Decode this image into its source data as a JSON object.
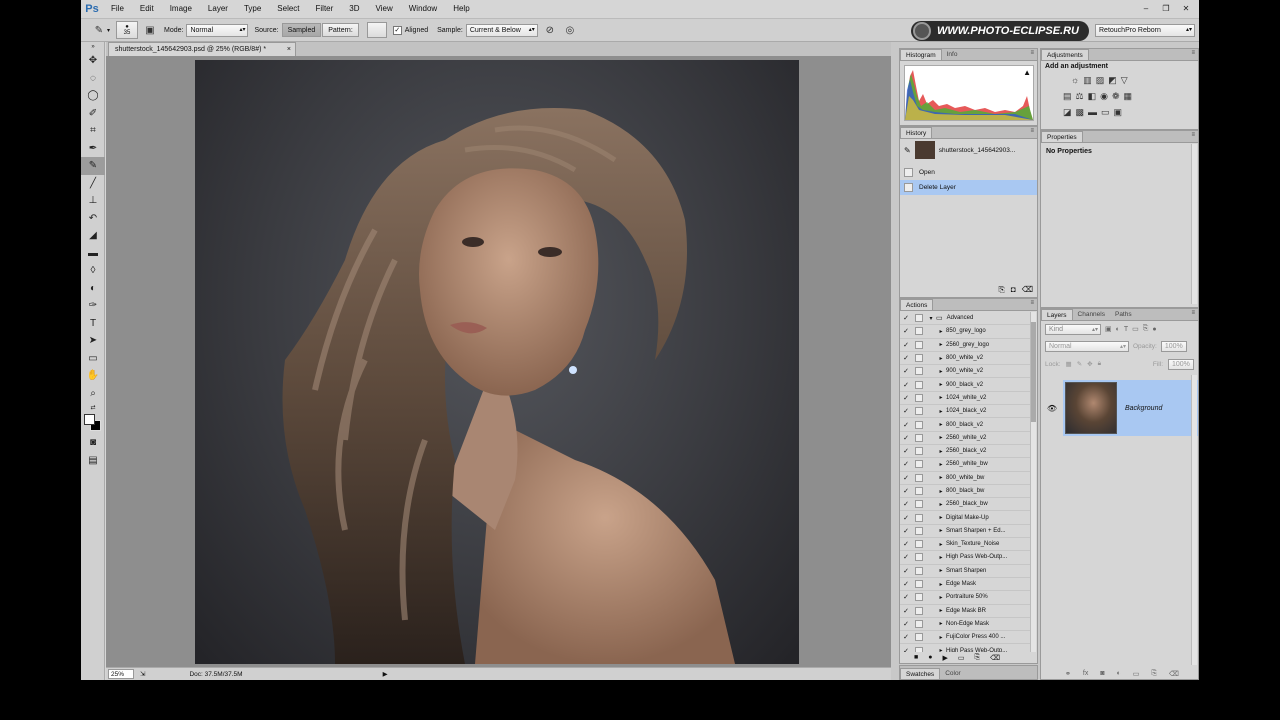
{
  "app": {
    "logo": "Ps",
    "win_controls": [
      "–",
      "❐",
      "✕"
    ]
  },
  "menu": [
    "File",
    "Edit",
    "Image",
    "Layer",
    "Type",
    "Select",
    "Filter",
    "3D",
    "View",
    "Window",
    "Help"
  ],
  "options": {
    "brush_size": "35",
    "mode_label": "Mode:",
    "mode_value": "Normal",
    "source_label": "Source:",
    "sampled": "Sampled",
    "pattern": "Pattern:",
    "aligned": "Aligned",
    "sample_label": "Sample:",
    "sample_value": "Current & Below",
    "brand": "WWW.PHOTO-ECLIPSE.RU",
    "preset": "RetouchPro Reborn"
  },
  "document": {
    "tab_title": "shutterstock_145642903.psd @ 25% (RGB/8#) *",
    "close": "×"
  },
  "status": {
    "zoom": "25%",
    "doc_size": "Doc: 37.5M/37.5M",
    "arrow": "▶"
  },
  "panels": {
    "histogram": {
      "tabs": [
        "Histogram",
        "Info"
      ],
      "warning": "▲"
    },
    "history": {
      "tab": "History",
      "snapshot": "shutterstock_145642903...",
      "items": [
        "Open",
        "Delete Layer"
      ]
    },
    "actions": {
      "tab": "Actions",
      "set": "Advanced",
      "items": [
        "850_grey_logo",
        "2560_grey_logo",
        "800_white_v2",
        "900_white_v2",
        "900_black_v2",
        "1024_white_v2",
        "1024_black_v2",
        "800_black_v2",
        "2560_white_v2",
        "2560_black_v2",
        "2560_white_bw",
        "800_white_bw",
        "800_black_bw",
        "2560_black_bw",
        "Digital Make-Up",
        "Smart Sharpen + Ed...",
        "Skin_Texture_Noise",
        "High Pass Web-Outp...",
        "Smart Sharpen",
        "Edge Mask",
        "Portraiture 50%",
        "Edge Mask BR",
        "Non-Edge Mask",
        "FujiColor Press 400 ...",
        "High Pass Web-Outp..."
      ]
    },
    "swatches": {
      "tabs": [
        "Swatches",
        "Color"
      ]
    },
    "adjustments": {
      "tab": "Adjustments",
      "title": "Add an adjustment"
    },
    "properties": {
      "tab": "Properties",
      "text": "No Properties"
    },
    "layers": {
      "tabs": [
        "Layers",
        "Channels",
        "Paths"
      ],
      "kind": "Kind",
      "blend": "Normal",
      "opacity_label": "Opacity:",
      "opacity": "100%",
      "lock_label": "Lock:",
      "fill_label": "Fill:",
      "fill": "100%",
      "layer_name": "Background"
    }
  }
}
